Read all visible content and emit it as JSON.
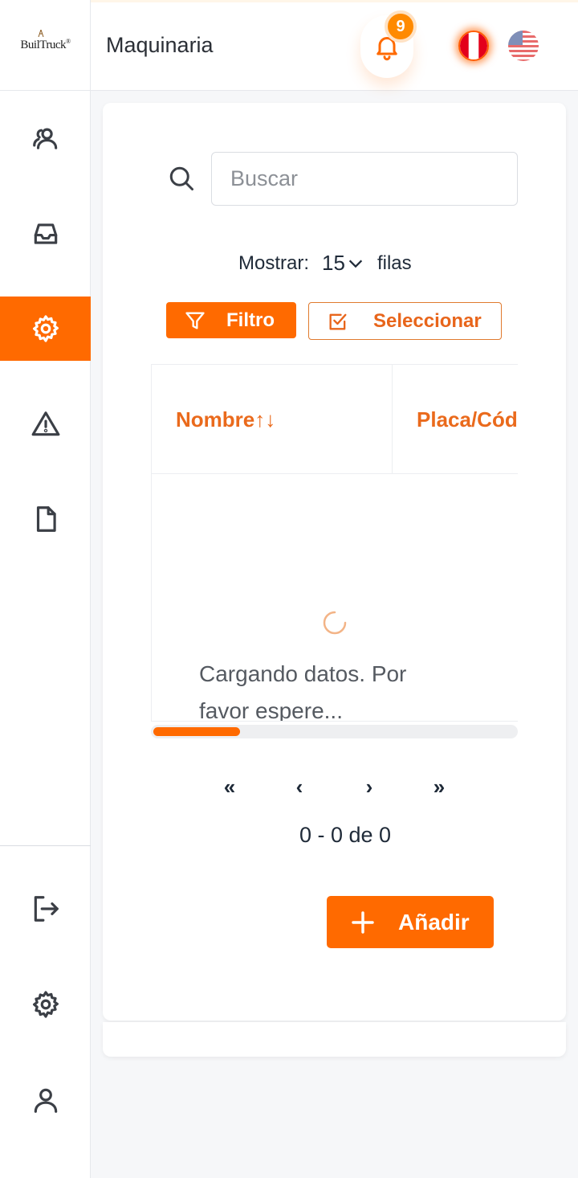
{
  "brand": {
    "logo_text": "BuilTruck",
    "logo_mark": "®"
  },
  "header": {
    "title": "Maquinaria",
    "notifications_count": "9"
  },
  "sidebar": {
    "items": [
      {
        "icon": "users-icon"
      },
      {
        "icon": "inbox-icon"
      },
      {
        "icon": "gear-icon",
        "active": true
      },
      {
        "icon": "warning-icon"
      },
      {
        "icon": "document-icon"
      }
    ],
    "bottom": [
      {
        "icon": "logout-icon"
      },
      {
        "icon": "settings-icon"
      },
      {
        "icon": "user-icon"
      }
    ]
  },
  "search": {
    "placeholder": "Buscar",
    "value": ""
  },
  "rows": {
    "label": "Mostrar:",
    "value": "15",
    "suffix": "filas"
  },
  "toolbar": {
    "filter_label": "Filtro",
    "select_label": "Seleccionar"
  },
  "table": {
    "columns": [
      "Nombre↑↓",
      "Placa/Código"
    ],
    "loading_text": "Cargando datos. Por favor espere...",
    "scroll_position": 0.24
  },
  "pagination": {
    "first": "«",
    "prev": "‹",
    "next": "›",
    "last": "»",
    "info": "0 - 0 de 0"
  },
  "actions": {
    "add_label": "Añadir"
  },
  "colors": {
    "accent": "#ff6a00",
    "accent_text": "#ea6a1c",
    "badge": "#ff8a00"
  }
}
